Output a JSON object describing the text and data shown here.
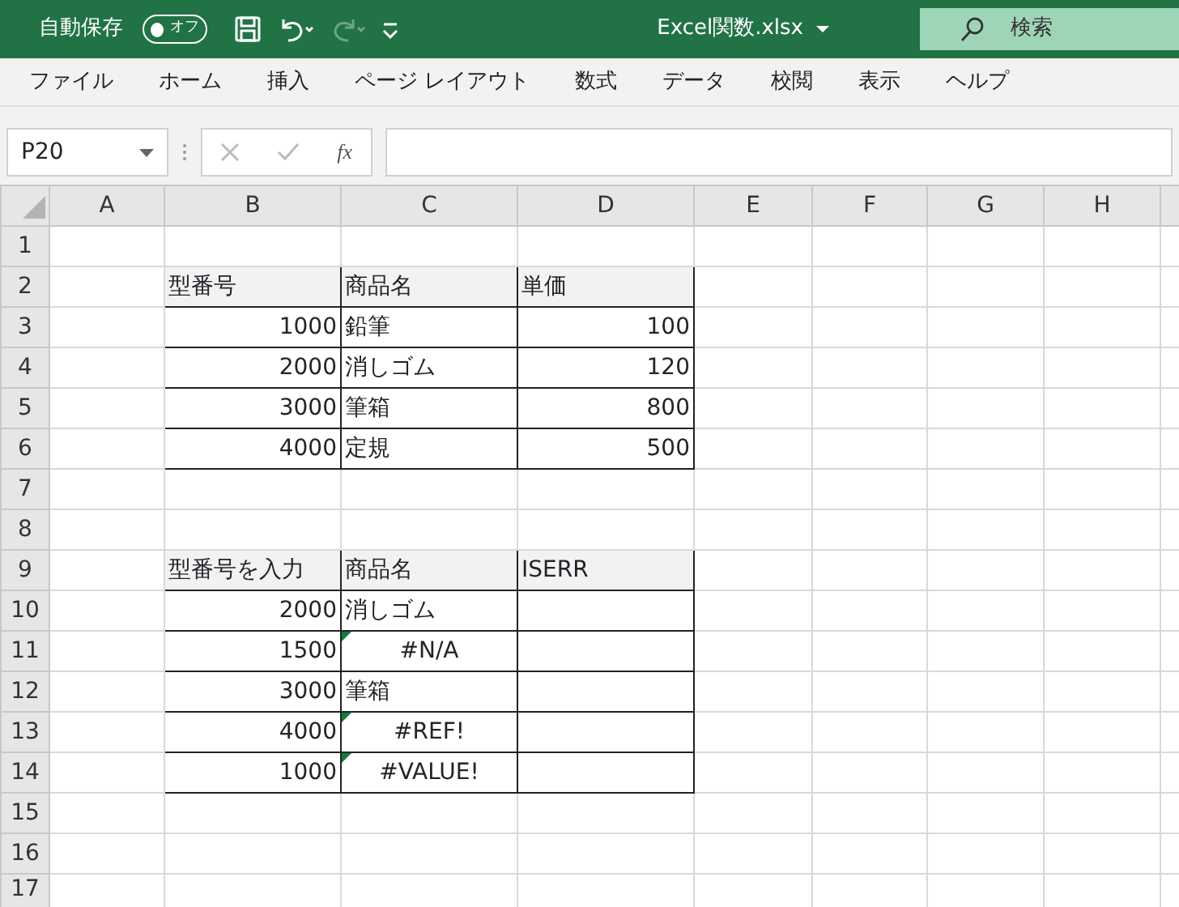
{
  "title_bar": {
    "autosave_label": "自動保存",
    "autosave": {
      "on": false,
      "label": "オフ"
    },
    "redo_disabled": true,
    "file_name": "Excel関数.xlsx",
    "search_placeholder": "検索"
  },
  "ribbon_tabs": [
    {
      "label": "ファイル",
      "selected": false
    },
    {
      "label": "ホーム",
      "selected": false
    },
    {
      "label": "挿入",
      "selected": false
    },
    {
      "label": "ページ レイアウト",
      "selected": false
    },
    {
      "label": "数式",
      "selected": false
    },
    {
      "label": "データ",
      "selected": false
    },
    {
      "label": "校閲",
      "selected": false
    },
    {
      "label": "表示",
      "selected": false
    },
    {
      "label": "ヘルプ",
      "selected": false
    }
  ],
  "formula_bar": {
    "name_box": "P20",
    "function_button": "fx"
  },
  "sheet": {
    "columns": [
      "A",
      "B",
      "C",
      "D",
      "E",
      "F",
      "G",
      "H"
    ],
    "rows": [
      {
        "number": "1",
        "cells": []
      },
      {
        "number": "2",
        "cells": [
          "",
          {
            "kind": "header",
            "text": "型番号"
          },
          {
            "kind": "header",
            "text": "商品名"
          },
          {
            "kind": "header",
            "text": "単価"
          }
        ]
      },
      {
        "number": "3",
        "cells": [
          "",
          {
            "kind": "number",
            "text": "1000"
          },
          {
            "kind": "text",
            "text": "鉛筆"
          },
          {
            "kind": "number",
            "text": "100"
          }
        ]
      },
      {
        "number": "4",
        "cells": [
          "",
          {
            "kind": "number",
            "text": "2000"
          },
          {
            "kind": "text",
            "text": "消しゴム"
          },
          {
            "kind": "number",
            "text": "120"
          }
        ]
      },
      {
        "number": "5",
        "cells": [
          "",
          {
            "kind": "number",
            "text": "3000"
          },
          {
            "kind": "text",
            "text": "筆箱"
          },
          {
            "kind": "number",
            "text": "800"
          }
        ]
      },
      {
        "number": "6",
        "cells": [
          "",
          {
            "kind": "number",
            "text": "4000"
          },
          {
            "kind": "text",
            "text": "定規"
          },
          {
            "kind": "number",
            "text": "500"
          }
        ]
      },
      {
        "number": "7",
        "cells": []
      },
      {
        "number": "8",
        "cells": []
      },
      {
        "number": "9",
        "cells": [
          "",
          {
            "kind": "header",
            "text": "型番号を入力"
          },
          {
            "kind": "header",
            "text": "商品名"
          },
          {
            "kind": "header",
            "text": "ISERR"
          }
        ]
      },
      {
        "number": "10",
        "cells": [
          "",
          {
            "kind": "number",
            "text": "2000"
          },
          {
            "kind": "text",
            "text": "消しゴム"
          },
          {
            "kind": "blank"
          }
        ]
      },
      {
        "number": "11",
        "cells": [
          "",
          {
            "kind": "number",
            "text": "1500"
          },
          {
            "kind": "error",
            "text": "#N/A"
          },
          {
            "kind": "blank"
          }
        ]
      },
      {
        "number": "12",
        "cells": [
          "",
          {
            "kind": "number",
            "text": "3000"
          },
          {
            "kind": "text",
            "text": "筆箱"
          },
          {
            "kind": "blank"
          }
        ]
      },
      {
        "number": "13",
        "cells": [
          "",
          {
            "kind": "number",
            "text": "4000"
          },
          {
            "kind": "error",
            "text": "#REF!"
          },
          {
            "kind": "blank"
          }
        ]
      },
      {
        "number": "14",
        "cells": [
          "",
          {
            "kind": "number",
            "text": "1000"
          },
          {
            "kind": "error",
            "text": "#VALUE!"
          },
          {
            "kind": "blank"
          }
        ]
      },
      {
        "number": "15",
        "cells": []
      },
      {
        "number": "16",
        "cells": []
      },
      {
        "number": "17",
        "cells": []
      }
    ]
  }
}
